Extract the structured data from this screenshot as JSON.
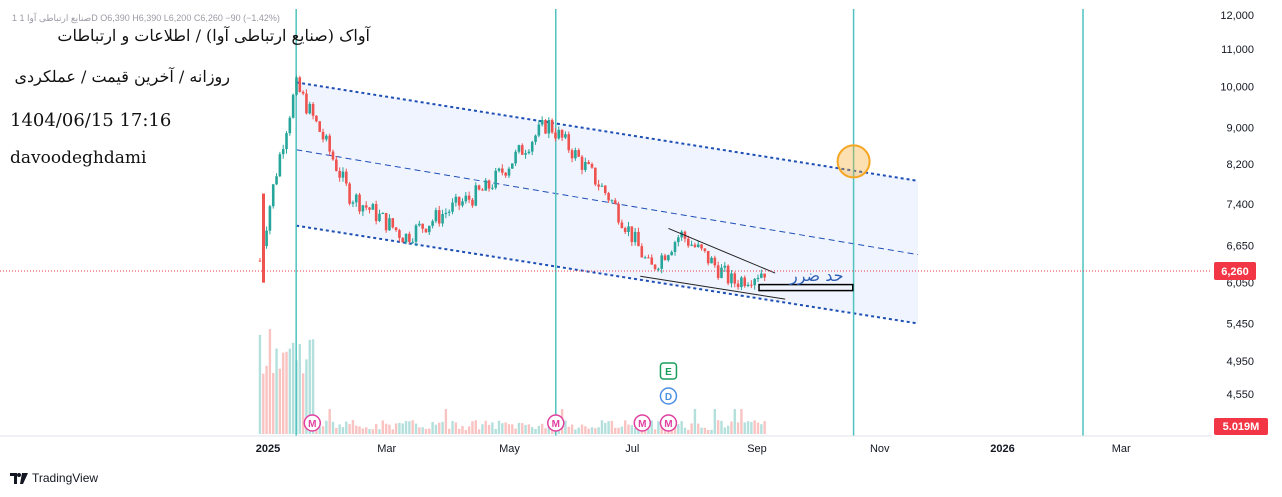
{
  "header": {
    "ohlc_line": "1  صنایع ارتباطی آوا 1D  O6,390  H6,390  L6,200  C6,260  −90 (−1.42%)",
    "title": "آواک (صنایع ارتباطی آوا) / اطلاعات و ارتباطات",
    "subtitle": "روزانه / آخرین قیمت / عملکردی",
    "timestamp": "1404/06/15 17:16",
    "author": "davoodeghdami"
  },
  "annotations": {
    "stop_loss_label": "حد ضرر"
  },
  "price_axis": {
    "ticks": [
      "12,000",
      "11,000",
      "10,000",
      "9,000",
      "8,200",
      "7,400",
      "6,650",
      "6,050",
      "5,450",
      "4,950",
      "4,550"
    ],
    "last_price_label": "6,260",
    "volume_label": "5.019M"
  },
  "time_axis": {
    "labels": [
      {
        "text": "2025",
        "bold": true
      },
      {
        "text": "Mar",
        "bold": false
      },
      {
        "text": "May",
        "bold": false
      },
      {
        "text": "Jul",
        "bold": false
      },
      {
        "text": "Sep",
        "bold": false
      },
      {
        "text": "Nov",
        "bold": false
      },
      {
        "text": "2026",
        "bold": true
      },
      {
        "text": "Mar",
        "bold": false
      }
    ]
  },
  "markers": {
    "m_label": "M",
    "e_label": "E",
    "d_label": "D"
  },
  "footer": {
    "brand": "TradingView"
  },
  "colors": {
    "up": "#26a69a",
    "down": "#ef5350",
    "channel": "#1e4fb5",
    "vline": "#4fc3c0",
    "circle": "#f5a623",
    "last_price_bg": "#f23645",
    "marker_m": "#e040a0",
    "marker_e": "#1a9e5c",
    "marker_d": "#4a90e2"
  },
  "chart_data": {
    "type": "candlestick",
    "symbol": "آواک",
    "interval": "1D",
    "last_close": 6260,
    "change": -90,
    "change_pct": -1.42,
    "y_scale": "log",
    "ylim": [
      4300,
      12300
    ],
    "ohlc_sample": [
      {
        "date": "2024-12-28",
        "close": 6400
      },
      {
        "date": "2025-01-15",
        "close": 10000
      },
      {
        "date": "2025-02-10",
        "close": 7600
      },
      {
        "date": "2025-03-10",
        "close": 6800
      },
      {
        "date": "2025-04-20",
        "close": 7700
      },
      {
        "date": "2025-05-20",
        "close": 9100
      },
      {
        "date": "2025-06-20",
        "close": 7500
      },
      {
        "date": "2025-07-10",
        "close": 6250
      },
      {
        "date": "2025-07-25",
        "close": 6850
      },
      {
        "date": "2025-08-20",
        "close": 6050
      },
      {
        "date": "2025-09-06",
        "close": 6260
      }
    ],
    "channel": {
      "upper": [
        {
          "date": "2025-01-15",
          "price": 10100
        },
        {
          "date": "2025-11-20",
          "price": 7850
        }
      ],
      "middle": [
        {
          "date": "2025-01-15",
          "price": 8500
        },
        {
          "date": "2025-11-20",
          "price": 6500
        }
      ],
      "lower": [
        {
          "date": "2025-01-15",
          "price": 7000
        },
        {
          "date": "2025-11-20",
          "price": 5450
        }
      ]
    },
    "stop_loss_zone": {
      "from": "2025-09-02",
      "to": "2025-11-01",
      "price_top": 6020,
      "price_bottom": 5930
    },
    "target_circle": {
      "date": "2025-10-19",
      "price": 8250
    },
    "vertical_lines": [
      "2025-01-15",
      "2025-05-24",
      "2025-10-19",
      "2026-02-10"
    ],
    "volume_last": "5.019M"
  }
}
